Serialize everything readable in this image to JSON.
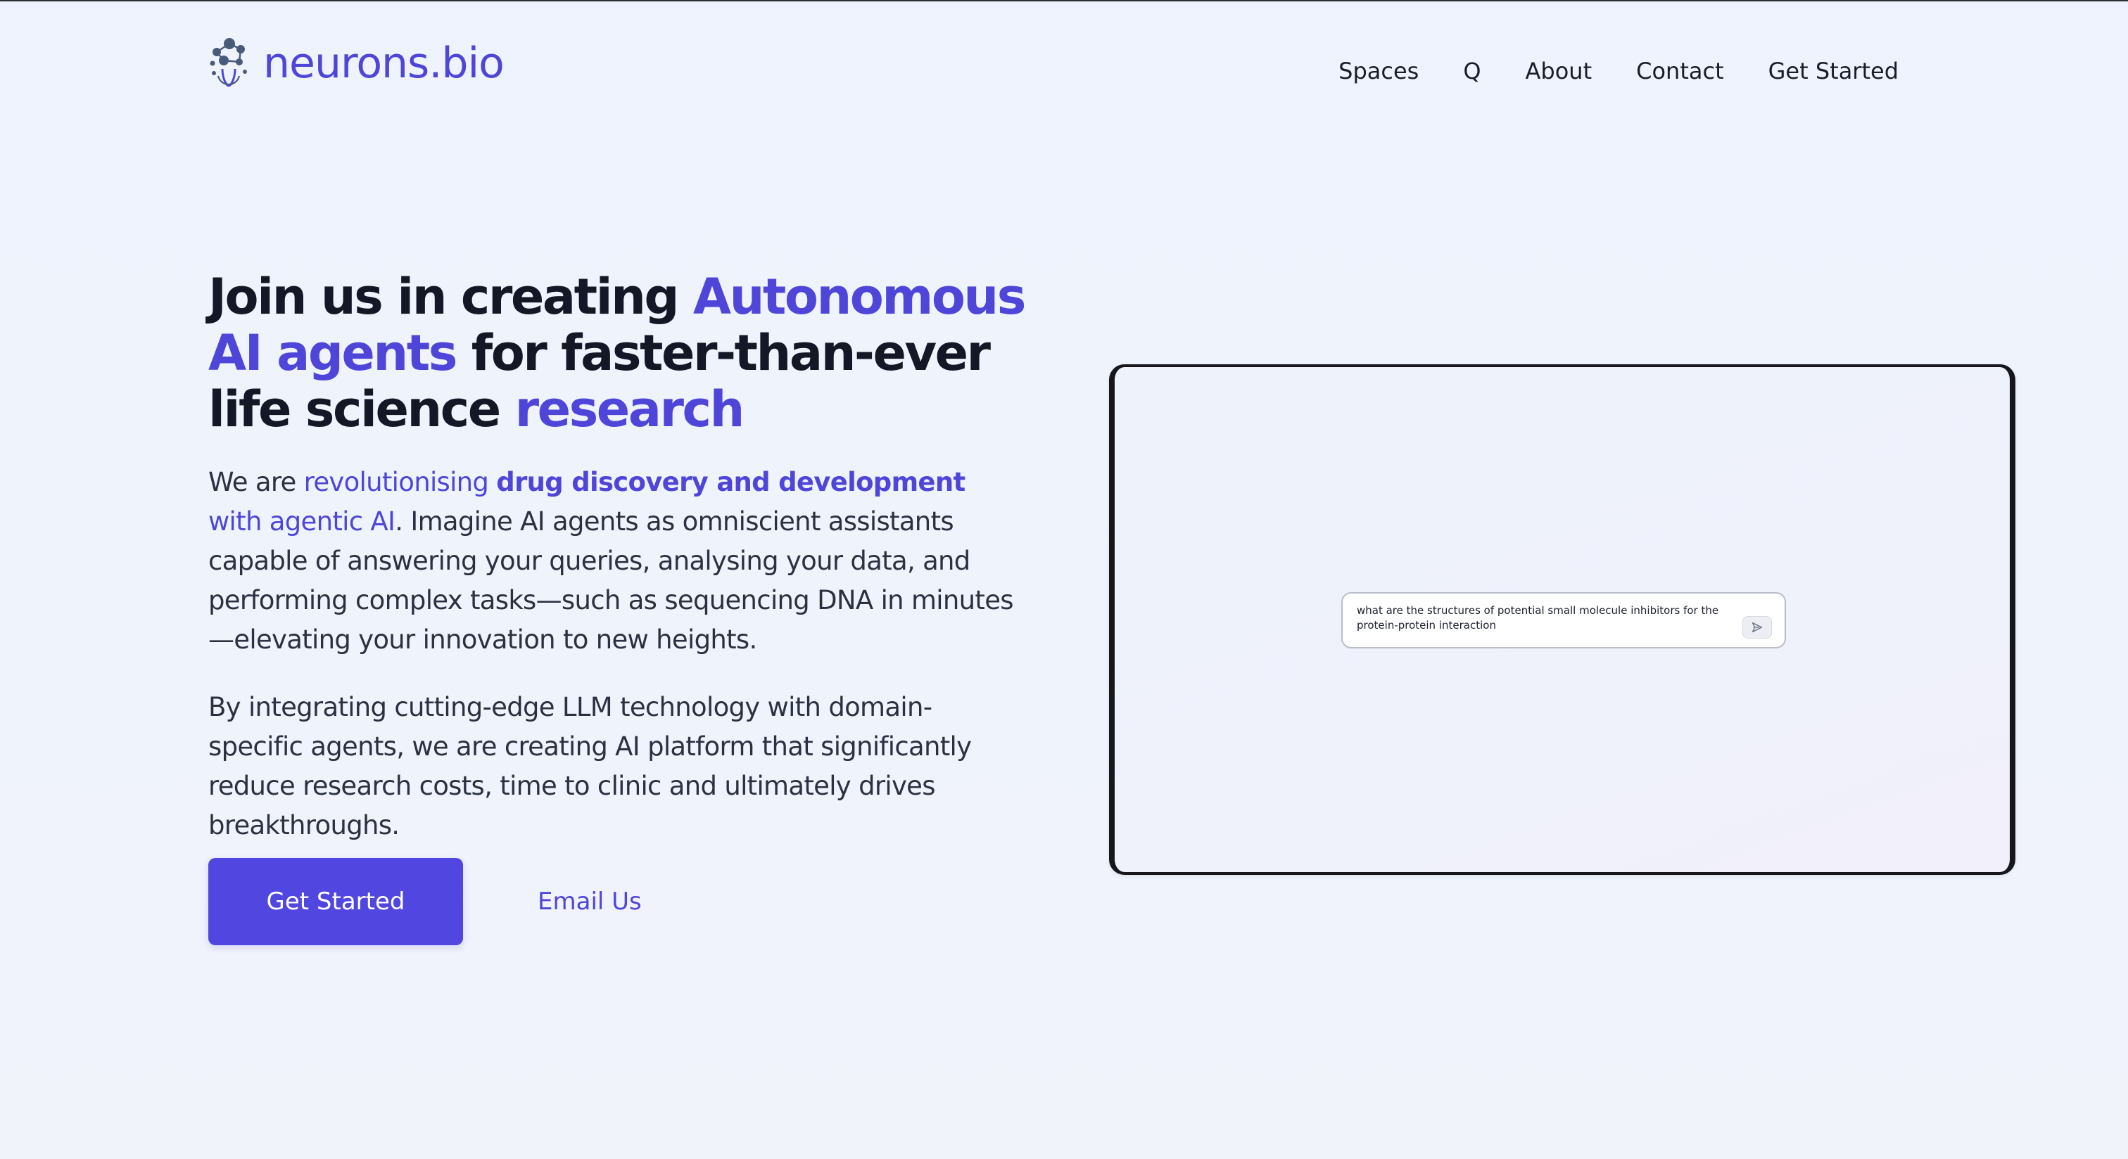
{
  "brand": {
    "name": "neurons.bio",
    "icon": "molecule-logo-icon",
    "color": "#4f46d9"
  },
  "nav": {
    "items": [
      {
        "label": "Spaces"
      },
      {
        "label": "Q"
      },
      {
        "label": "About"
      },
      {
        "label": "Contact"
      },
      {
        "label": "Get Started"
      }
    ]
  },
  "hero": {
    "title": {
      "part1": "Join us in creating ",
      "accent1": "Autonomous AI agents",
      "part2": " for faster-than-ever life science ",
      "accent2": "research"
    },
    "paragraph1": {
      "lead": "We are ",
      "accent1": "revolutionising ",
      "accent_bold": "drug discovery and development",
      "accent2": " with agentic AI",
      "rest": ". Imagine AI agents as omniscient assistants capable of answering your queries, analysing your data, and performing complex tasks—such as sequencing DNA in minutes—elevating your innovation to new heights."
    },
    "paragraph2": "By integrating cutting-edge LLM technology with domain-specific agents, we are creating AI platform that significantly reduce research costs, time to clinic and ultimately drives breakthroughs.",
    "cta_primary": "Get Started",
    "cta_secondary": "Email Us"
  },
  "preview": {
    "chat_query": "what are the structures of potential small molecule inhibitors for the protein-protein interaction",
    "send_icon": "send-icon"
  },
  "colors": {
    "accent": "#4f46d9",
    "button": "#5146df",
    "background": "#eef3fd",
    "text": "#141826"
  }
}
